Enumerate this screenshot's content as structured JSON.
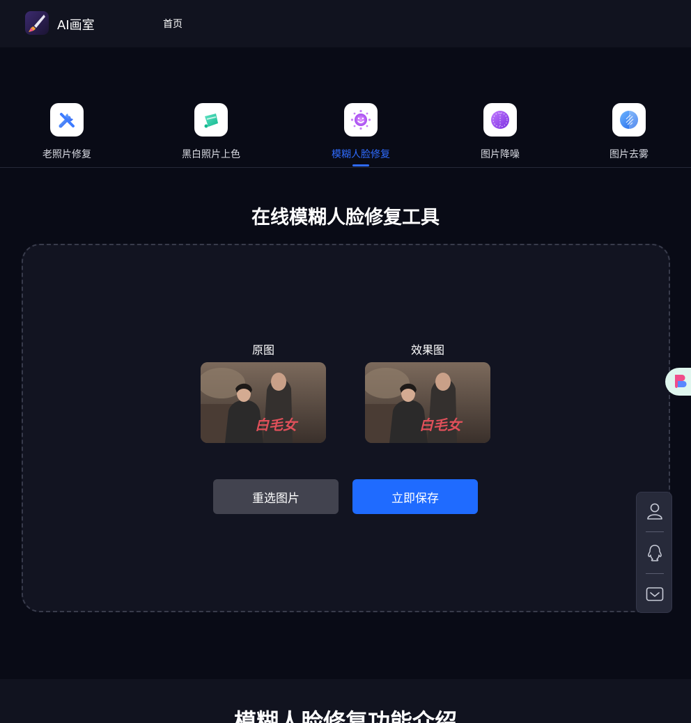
{
  "header": {
    "brand": "AI画室",
    "nav": {
      "home": "首页"
    }
  },
  "tabs": [
    {
      "label": "老照片修复",
      "icon": "wrench-icon",
      "active": false
    },
    {
      "label": "黑白照片上色",
      "icon": "paint-bucket-icon",
      "active": false
    },
    {
      "label": "模糊人脸修复",
      "icon": "face-icon",
      "active": true
    },
    {
      "label": "图片降噪",
      "icon": "noise-icon",
      "active": false
    },
    {
      "label": "图片去雾",
      "icon": "dehaze-icon",
      "active": false
    }
  ],
  "tool": {
    "title": "在线模糊人脸修复工具",
    "original_label": "原图",
    "result_label": "效果图",
    "reselect_label": "重选图片",
    "save_label": "立即保存"
  },
  "photo_caption": "白毛女",
  "intro": {
    "title": "模糊人脸修复功能介绍"
  },
  "colors": {
    "accent": "#2f6cff",
    "button_primary": "#1f6bff",
    "button_secondary": "#42434f",
    "background": "#090b16"
  }
}
